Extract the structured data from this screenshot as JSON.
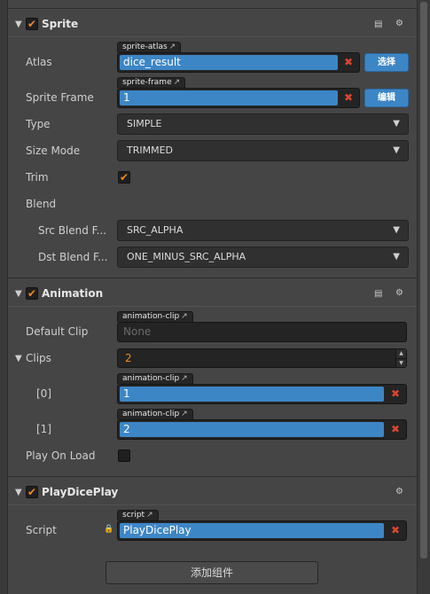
{
  "sprite": {
    "title": "Sprite",
    "enabled": true,
    "atlas": {
      "label": "Atlas",
      "tag": "sprite-atlas",
      "value": "dice_result",
      "button": "选择"
    },
    "sprite_frame": {
      "label": "Sprite Frame",
      "tag": "sprite-frame",
      "value": "1",
      "button": "编辑"
    },
    "type": {
      "label": "Type",
      "value": "SIMPLE"
    },
    "size_mode": {
      "label": "Size Mode",
      "value": "TRIMMED"
    },
    "trim": {
      "label": "Trim",
      "checked": true
    },
    "blend": {
      "label": "Blend"
    },
    "src_blend": {
      "label": "Src Blend F...",
      "value": "SRC_ALPHA"
    },
    "dst_blend": {
      "label": "Dst Blend F...",
      "value": "ONE_MINUS_SRC_ALPHA"
    }
  },
  "animation": {
    "title": "Animation",
    "enabled": true,
    "default_clip": {
      "label": "Default Clip",
      "tag": "animation-clip",
      "placeholder": "None"
    },
    "clips": {
      "label": "Clips",
      "count": "2"
    },
    "clip_items": [
      {
        "label": "[0]",
        "tag": "animation-clip",
        "value": "1"
      },
      {
        "label": "[1]",
        "tag": "animation-clip",
        "value": "2"
      }
    ],
    "play_on_load": {
      "label": "Play On Load",
      "checked": false
    }
  },
  "play_dice_play": {
    "title": "PlayDicePlay",
    "enabled": true,
    "script": {
      "label": "Script",
      "tag": "script",
      "value": "PlayDicePlay"
    }
  },
  "add_component_label": "添加组件",
  "glyphs": {
    "fold_open": "▼",
    "check": "✔",
    "remove": "✖",
    "dropdown": "▼",
    "external": "↗",
    "lock": "🔒",
    "gear": "⚙",
    "book": "▤",
    "spin_up": "▲",
    "spin_down": "▼"
  },
  "colors": {
    "accent_blue": "#3d86c6",
    "check_orange": "#f0891e",
    "remove_red": "#d9452f"
  }
}
